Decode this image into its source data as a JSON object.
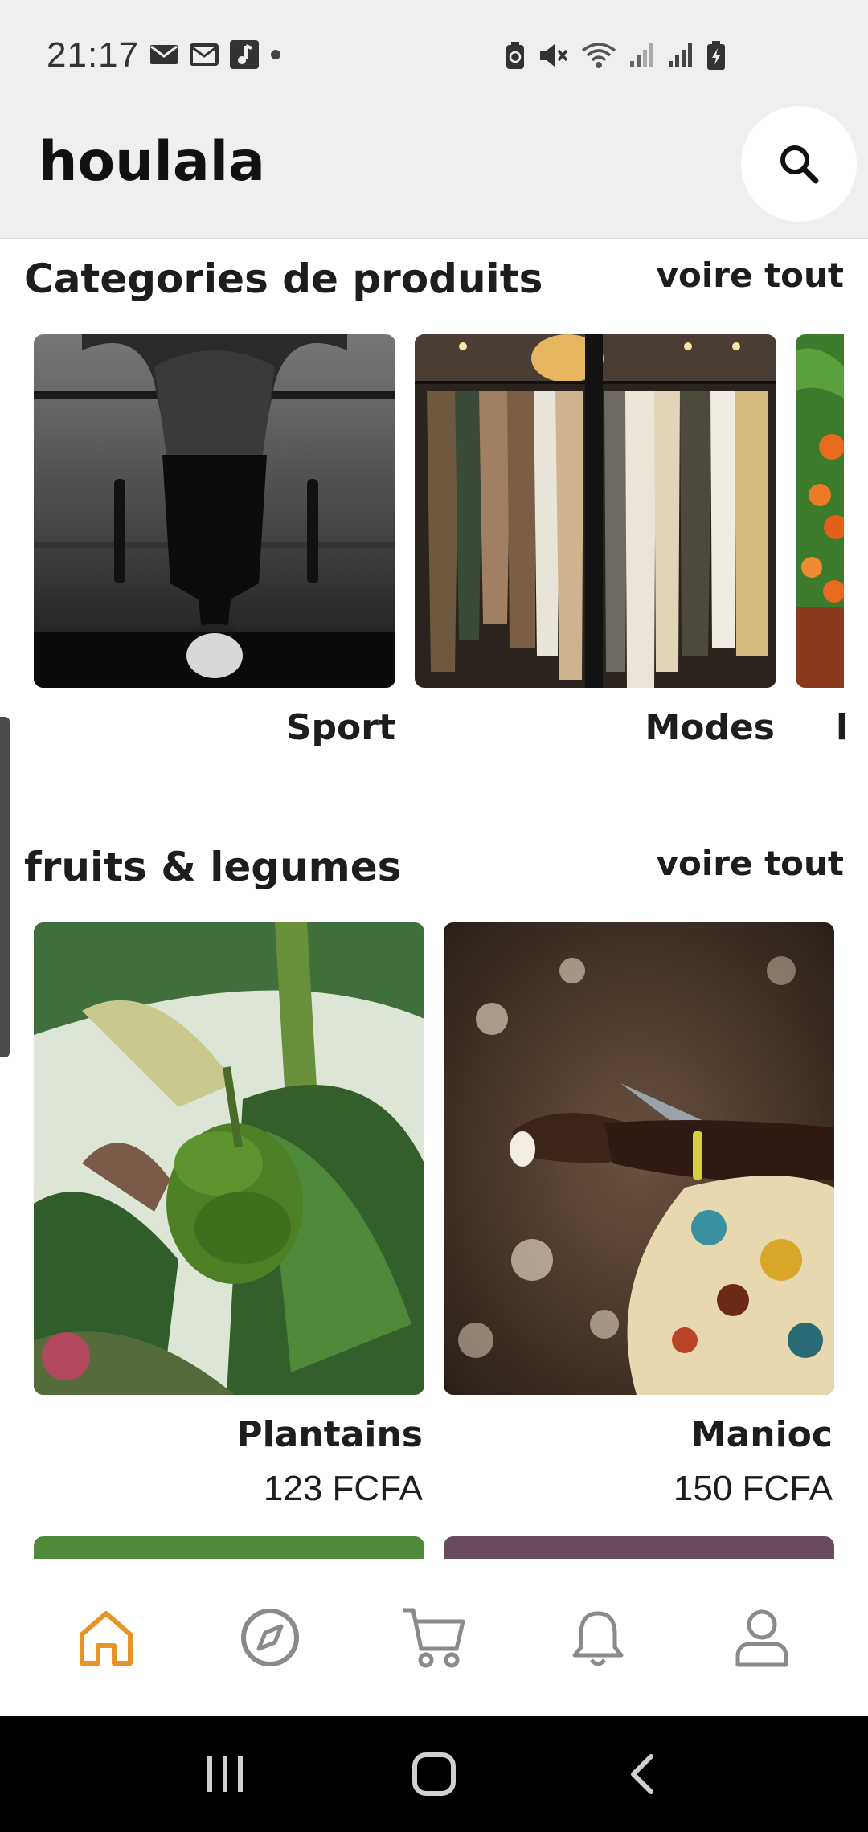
{
  "status_bar": {
    "time": "21:17",
    "left_icons": [
      "email-icon",
      "email-outline-icon",
      "music-icon",
      "dot-icon"
    ],
    "right_icons": [
      "battery-saver-icon",
      "mute-icon",
      "wifi-icon",
      "signal-icon",
      "signal-icon",
      "battery-charging-icon"
    ]
  },
  "header": {
    "title": "houlala",
    "search_icon": "search-icon"
  },
  "categories_section": {
    "title": "Categories de produits",
    "see_all": "voire tout",
    "items": [
      {
        "label": "Sport",
        "image": "sport-image"
      },
      {
        "label": "Modes",
        "image": "fashion-image"
      },
      {
        "label": "l",
        "image": "fruits-image"
      }
    ]
  },
  "fruits_section": {
    "title": "fruits & legumes",
    "see_all": "voire tout",
    "products": [
      {
        "name": "Plantains",
        "price": "123 FCFA",
        "image": "plantain-image"
      },
      {
        "name": "Manioc",
        "price": "150 FCFA",
        "image": "cassava-image"
      }
    ]
  },
  "bottom_nav": {
    "items": [
      {
        "name": "home",
        "icon": "home-icon",
        "active": true
      },
      {
        "name": "explore",
        "icon": "compass-icon",
        "active": false
      },
      {
        "name": "cart",
        "icon": "cart-icon",
        "active": false
      },
      {
        "name": "notifications",
        "icon": "bell-icon",
        "active": false
      },
      {
        "name": "profile",
        "icon": "user-icon",
        "active": false
      }
    ]
  },
  "colors": {
    "accent": "#e8922a",
    "icon_gray": "#8a8a8a",
    "header_bg": "#efefef"
  }
}
